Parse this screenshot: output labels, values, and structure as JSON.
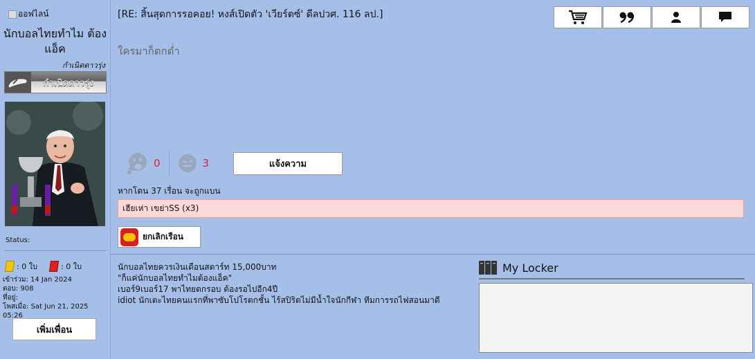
{
  "profile": {
    "status": "ออฟไลน์",
    "username": "นักบอลไทยทำไม ต้องแอ็ค",
    "rank_title": "กำเนิดดาวรุ่ง",
    "rank_badge": "กำเนิดดาวรุ่ง",
    "status_label": "Status:",
    "yellow_cards": ": 0 ใบ",
    "red_cards": ": 0 ใบ",
    "joined": "เข้าร่วม: 14 Jan 2024",
    "replies": "ตอบ: 908",
    "location": "ที่อยู่:",
    "posted": "โพสเมื่อ: Sat Jun 21, 2025 05:26",
    "add_friend": "เพิ่มเพื่อน"
  },
  "post": {
    "title": "[RE: สิ้นสุดการรอคอย! หงส์เปิดตัว 'เวียร์ตซ์' ดีลปวศ. 116 ลป.]",
    "body": "ใครมาก็ตกต่ำ",
    "like_count": "0",
    "dislike_count": "3",
    "report_label": "แจ้งความ",
    "ban_note": "หากโดน 37 เรื่อน จะถูกแบน",
    "warning": "เฮียเห่า เขย่าSS (x3)",
    "cancel_label": "ยกเลิกเรือน"
  },
  "toolbar": {
    "icons": [
      "cart-icon",
      "quote-icon",
      "user-icon",
      "comment-icon"
    ]
  },
  "signature": {
    "lines": [
      "นักบอลไทยควรเงินเดือนสตาร์ท 15,000บาท",
      "\"ก็แค่นักบอลไทยทำไมต้องแอ็ค\"",
      "เบอร์9เบอร์17 พาไทยตกรอบ ต้องรอไปอีก4ปี",
      "idiot นักเตะไทยคนแรกที่พาซับโปโรตกชั้น ไร้สปิริตไม่มีน้ำใจนักกีฬา ทีมการรถไฟสอนมาดี"
    ]
  },
  "locker": {
    "title": "My Locker"
  },
  "colors": {
    "background": "#a6bfe9",
    "warning_bg": "#fcd9d9",
    "count_red": "#e02030"
  }
}
